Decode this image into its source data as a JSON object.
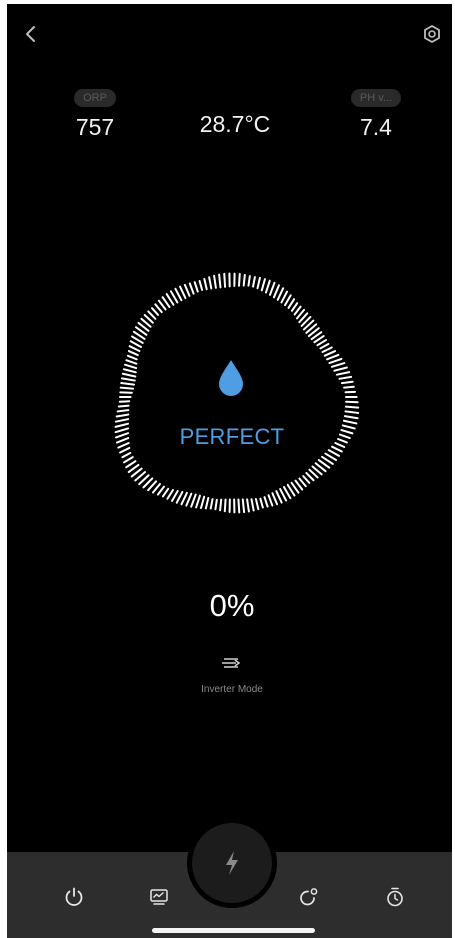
{
  "header": {
    "partial_title": "fragment cut off at top edge",
    "back_icon": "chevron-left-icon",
    "settings_icon": "gear-icon"
  },
  "metrics": {
    "orp": {
      "label": "ORP",
      "value": "757"
    },
    "temperature": {
      "value": "28.7°C"
    },
    "ph": {
      "label": "PH v...",
      "value": "7.4"
    }
  },
  "status": {
    "icon": "water-drop-icon",
    "text": "PERFECT",
    "color": "#4f9de3"
  },
  "output": {
    "percent": "0%",
    "mode_icon": "inverter-mode-icon",
    "mode_label": "Inverter Mode"
  },
  "nav": {
    "items": [
      {
        "icon": "power-icon"
      },
      {
        "icon": "monitor-chart-icon"
      },
      {
        "icon": "lightning-icon"
      },
      {
        "icon": "cycle-icon"
      },
      {
        "icon": "timer-icon"
      }
    ]
  },
  "colors": {
    "background": "#000000",
    "accent": "#4f9de3",
    "bottom_bar": "#2d2d2d",
    "chip": "#2a2a2a"
  }
}
